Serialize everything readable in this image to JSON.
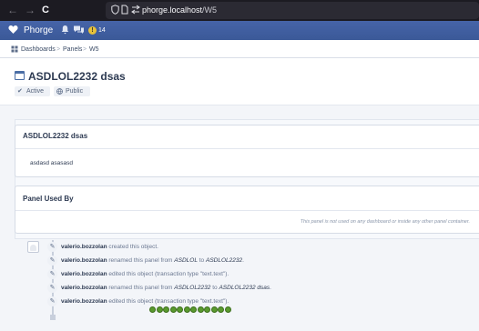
{
  "browser": {
    "back": "←",
    "forward": "→",
    "reload": "C",
    "url_host": "phorge.localhost",
    "url_path": "/W5",
    "shield_icon": "shield-icon",
    "page_icon": "page-icon",
    "permissions_icon": "permissions-icon"
  },
  "header": {
    "brand": "Phorge",
    "notification_count": "14",
    "badge_glyph": "!"
  },
  "breadcrumbs": {
    "items": [
      "Dashboards",
      "Panels",
      "W5"
    ],
    "sep": ">"
  },
  "page": {
    "title": "ASDLOL2232 dsas",
    "tags": [
      "Active",
      "Public"
    ]
  },
  "panel_main": {
    "title": "ASDLOL2232 dsas",
    "body": "asdasd asasasd"
  },
  "panel_used": {
    "title": "Panel Used By",
    "empty": "This panel is not used on any dashboard or inside any other panel container."
  },
  "timeline": [
    {
      "user": "valerio.bozzolan",
      "text": " created this object."
    },
    {
      "user": "valerio.bozzolan",
      "pre": " renamed this panel from ",
      "from": "ASDLOL",
      "mid": " to ",
      "to": "ASDLOL2232",
      "post": "."
    },
    {
      "user": "valerio.bozzolan",
      "text": " edited this object (transaction type \"text.text\")."
    },
    {
      "user": "valerio.bozzolan",
      "pre": " renamed this panel from ",
      "from": "ASDLOL2232",
      "mid": " to ",
      "to": "ASDLOL2232 dsas",
      "post": "."
    },
    {
      "user": "valerio.bozzolan",
      "text": " edited this object (transaction type \"text.text\")."
    }
  ],
  "colors": {
    "header_bg": "#3b5998",
    "token": "#5a9a2e"
  }
}
